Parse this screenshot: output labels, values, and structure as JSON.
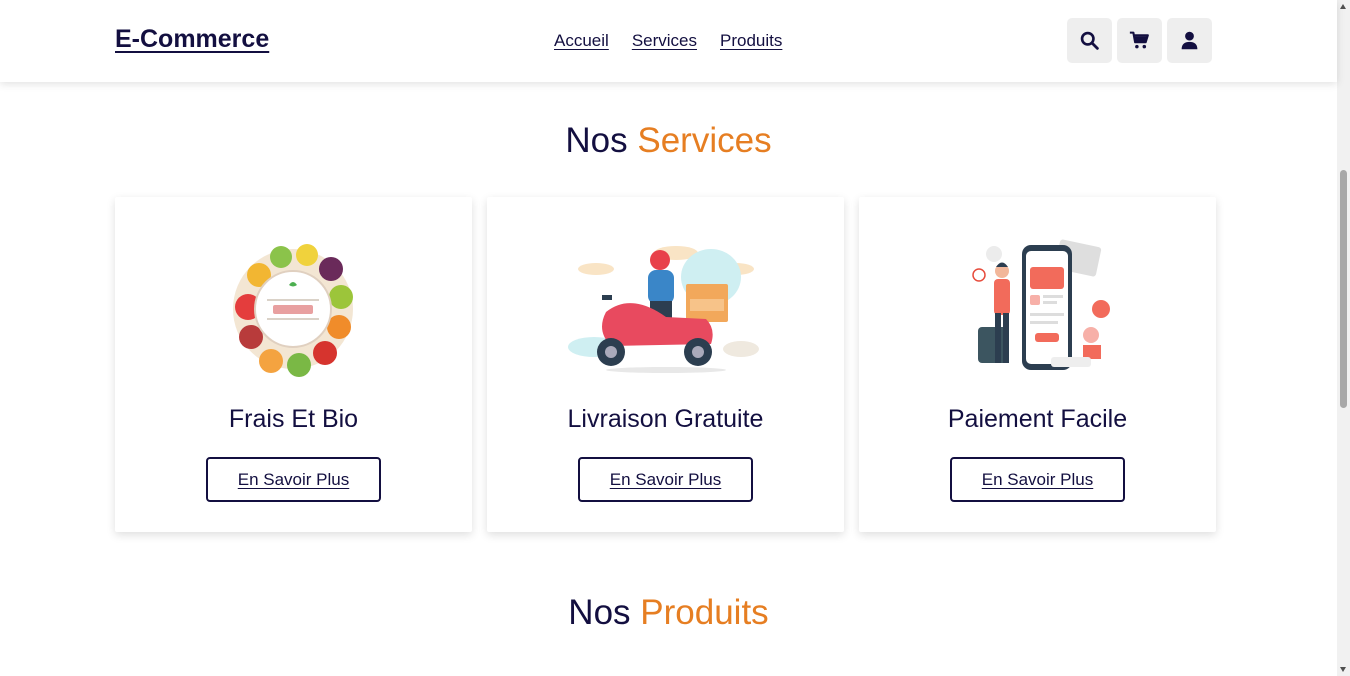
{
  "header": {
    "logo": "E-Commerce",
    "nav": [
      "Accueil",
      "Services",
      "Produits"
    ],
    "icons": [
      "search-icon",
      "cart-icon",
      "user-icon"
    ]
  },
  "services_heading": {
    "prefix": "Nos",
    "accent": "Services"
  },
  "services": [
    {
      "title": "Frais Et Bio",
      "button": "En Savoir Plus",
      "image": "organic-fruits-illustration"
    },
    {
      "title": "Livraison Gratuite",
      "button": "En Savoir Plus",
      "image": "delivery-scooter-illustration"
    },
    {
      "title": "Paiement Facile",
      "button": "En Savoir Plus",
      "image": "mobile-payment-illustration"
    }
  ],
  "products_heading": {
    "prefix": "Nos",
    "accent": "Produits"
  },
  "colors": {
    "primary": "#130f40",
    "accent": "#e67e22",
    "icon_bg": "#eeeeee"
  }
}
